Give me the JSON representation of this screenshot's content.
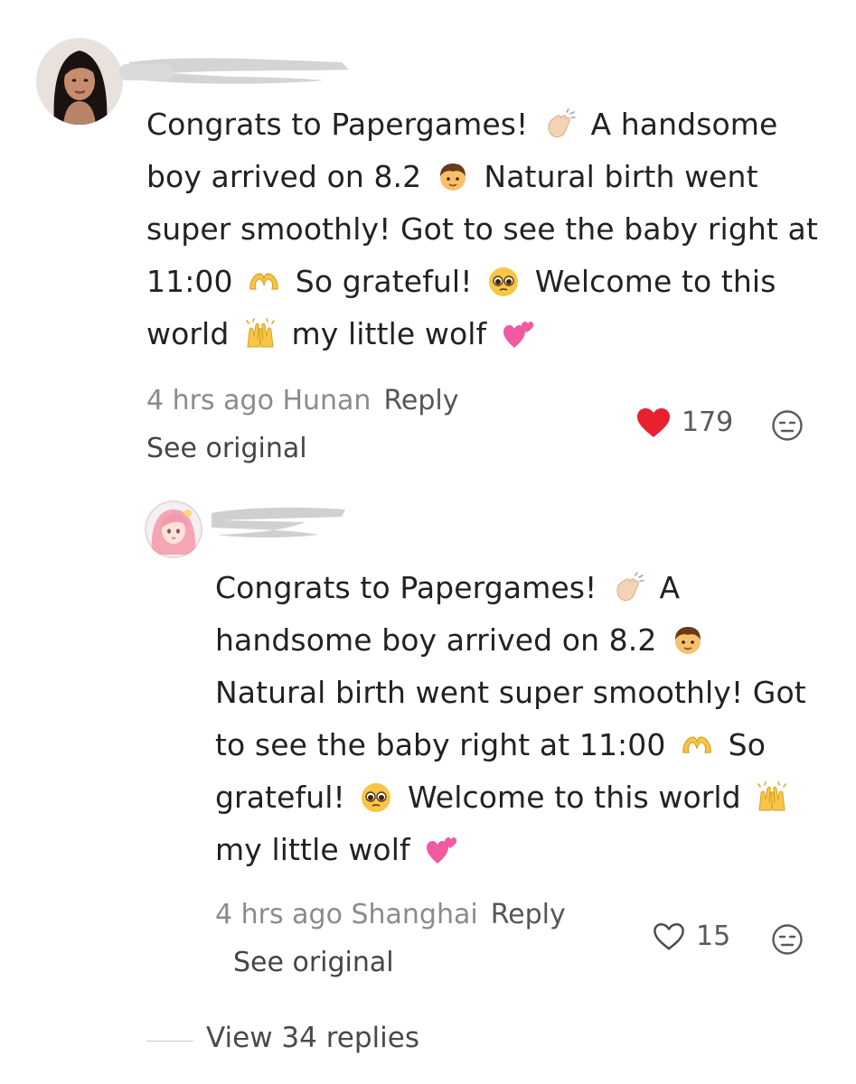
{
  "comments": [
    {
      "text": [
        "Congrats to Papergames! ",
        " A handsome boy arrived on 8.2 ",
        " Natural birth went super smoothly! Got to see the baby right at 11:00 ",
        " So grateful! ",
        " Welcome to this world ",
        " my little wolf "
      ],
      "emojis": [
        "clapping-hands",
        "boy",
        "heart-hands",
        "pleading-face",
        "raising-hands",
        "two-hearts"
      ],
      "time_location": "4 hrs ago Hunan",
      "reply_label": "Reply",
      "see_original": "See original",
      "likes": "179",
      "liked": true
    },
    {
      "text": [
        "Congrats to Papergames! ",
        " A handsome boy arrived on 8.2 ",
        " Natural birth went super smoothly! Got to see the baby right at 11:00 ",
        " So grateful! ",
        " Welcome to this world ",
        " my little wolf "
      ],
      "emojis": [
        "clapping-hands",
        "boy",
        "heart-hands",
        "pleading-face",
        "raising-hands",
        "two-hearts"
      ],
      "time_location": "4 hrs ago Shanghai",
      "reply_label": "Reply",
      "see_original": "See original",
      "likes": "15",
      "liked": false
    }
  ],
  "view_replies": "View 34 replies",
  "colors": {
    "like_active": "#e8202f",
    "meta_gray": "#8b8b8b",
    "text": "#222222"
  },
  "icons": [
    "heart-icon",
    "neutral-face-icon"
  ]
}
